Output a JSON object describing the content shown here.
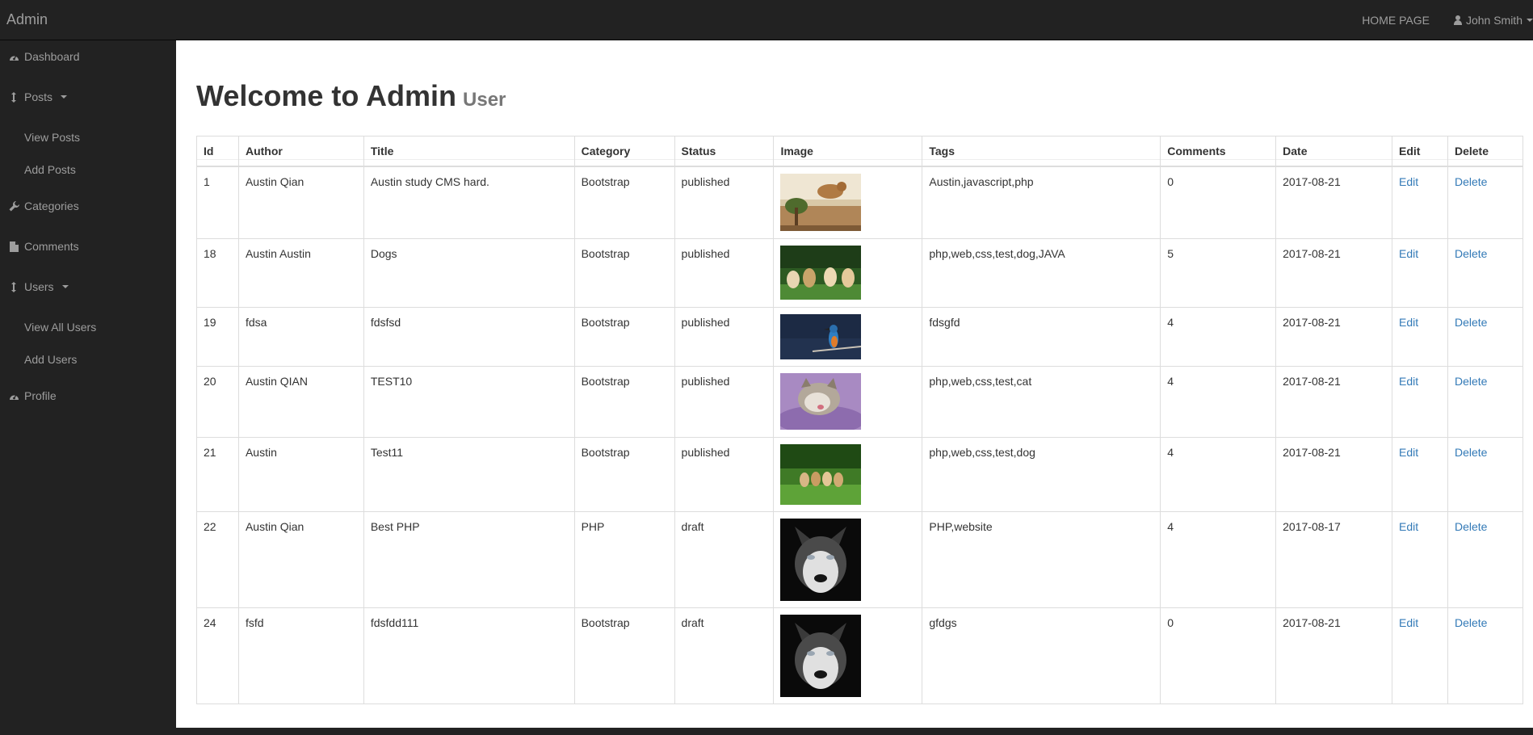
{
  "topbar": {
    "brand": "Admin",
    "home_link": "HOME PAGE",
    "user_name": "John Smith"
  },
  "sidebar": {
    "dashboard": "Dashboard",
    "posts": "Posts",
    "view_posts": "View Posts",
    "add_posts": "Add Posts",
    "categories": "Categories",
    "comments": "Comments",
    "users": "Users",
    "view_all_users": "View All Users",
    "add_users": "Add Users",
    "profile": "Profile"
  },
  "main": {
    "title": "Welcome to Admin",
    "subtitle": "User"
  },
  "table": {
    "headers": [
      "Id",
      "Author",
      "Title",
      "Category",
      "Status",
      "Image",
      "Tags",
      "Comments",
      "Date",
      "Edit",
      "Delete"
    ],
    "rows": [
      {
        "id": "1",
        "author": "Austin Qian",
        "title": "Austin study CMS hard.",
        "category": "Bootstrap",
        "status": "published",
        "image": "cat-jumping",
        "tags": "Austin,javascript,php",
        "comments": "0",
        "date": "2017-08-21",
        "edit": "Edit",
        "delete": "Delete"
      },
      {
        "id": "18",
        "author": "Austin Austin",
        "title": "Dogs",
        "category": "Bootstrap",
        "status": "published",
        "image": "puppies-on-grass",
        "tags": "php,web,css,test,dog,JAVA",
        "comments": "5",
        "date": "2017-08-21",
        "edit": "Edit",
        "delete": "Delete"
      },
      {
        "id": "19",
        "author": "fdsa",
        "title": "fdsfsd",
        "category": "Bootstrap",
        "status": "published",
        "image": "kingfisher-bird",
        "tags": "fdsgfd",
        "comments": "4",
        "date": "2017-08-21",
        "edit": "Edit",
        "delete": "Delete"
      },
      {
        "id": "20",
        "author": "Austin QIAN",
        "title": "TEST10",
        "category": "Bootstrap",
        "status": "published",
        "image": "kitten-in-blanket",
        "tags": "php,web,css,test,cat",
        "comments": "4",
        "date": "2017-08-21",
        "edit": "Edit",
        "delete": "Delete"
      },
      {
        "id": "21",
        "author": "Austin",
        "title": "Test11",
        "category": "Bootstrap",
        "status": "published",
        "image": "puppies-in-field",
        "tags": "php,web,css,test,dog",
        "comments": "4",
        "date": "2017-08-21",
        "edit": "Edit",
        "delete": "Delete"
      },
      {
        "id": "22",
        "author": "Austin Qian",
        "title": "Best PHP",
        "category": "PHP",
        "status": "draft",
        "image": "husky-portrait",
        "tags": "PHP,website",
        "comments": "4",
        "date": "2017-08-17",
        "edit": "Edit",
        "delete": "Delete"
      },
      {
        "id": "24",
        "author": "fsfd",
        "title": "fdsfdd111",
        "category": "Bootstrap",
        "status": "draft",
        "image": "husky-portrait",
        "tags": "gfdgs",
        "comments": "0",
        "date": "2017-08-21",
        "edit": "Edit",
        "delete": "Delete"
      }
    ]
  },
  "colors": {
    "navbar_bg": "#222222",
    "nav_text": "#9d9d9d",
    "link": "#337ab7",
    "border": "#dddddd"
  }
}
